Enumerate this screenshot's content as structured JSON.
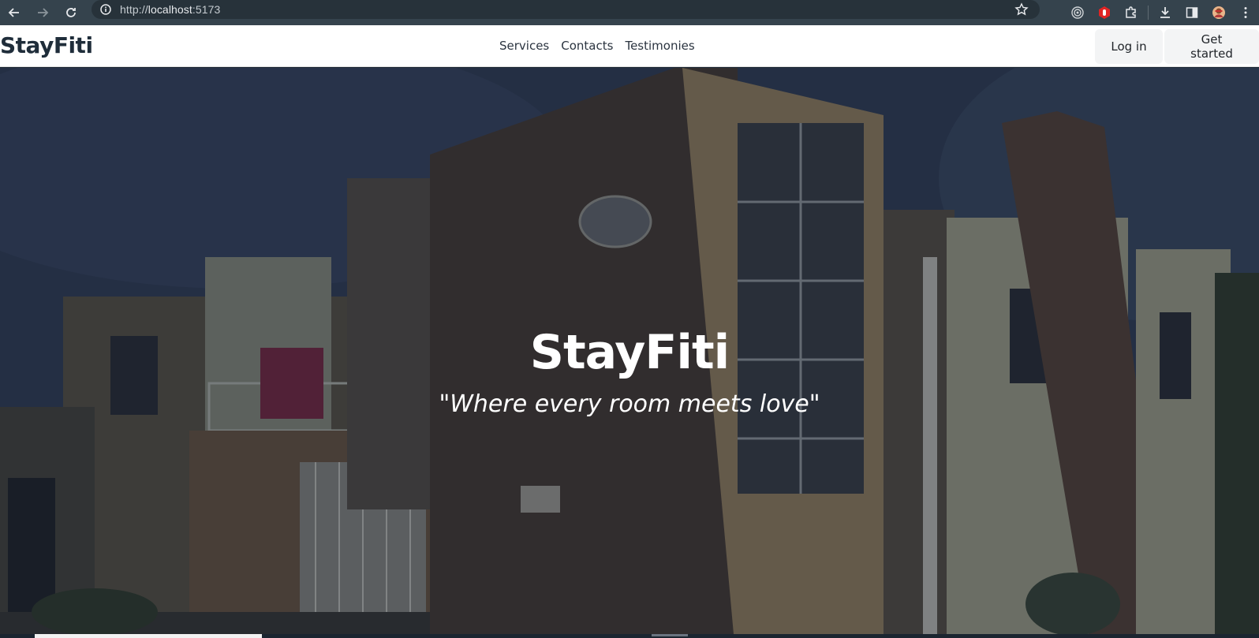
{
  "browser": {
    "url_scheme": "http://",
    "url_host": "localhost",
    "url_port": ":5173",
    "icons": [
      "back-arrow-icon",
      "forward-arrow-icon",
      "reload-icon",
      "site-info-icon",
      "bookmark-star-icon",
      "tracking-icon",
      "extension-red-icon",
      "extensions-puzzle-icon",
      "download-icon",
      "side-panel-icon",
      "profile-avatar-icon",
      "menu-kebab-icon"
    ]
  },
  "header": {
    "brand": "StayFiti",
    "nav": [
      {
        "label": "Services"
      },
      {
        "label": "Contacts"
      },
      {
        "label": "Testimonies"
      }
    ],
    "login_label": "Log in",
    "get_started_label": "Get started"
  },
  "hero": {
    "title": "StayFiti",
    "tagline": "\"Where every room meets love\""
  }
}
